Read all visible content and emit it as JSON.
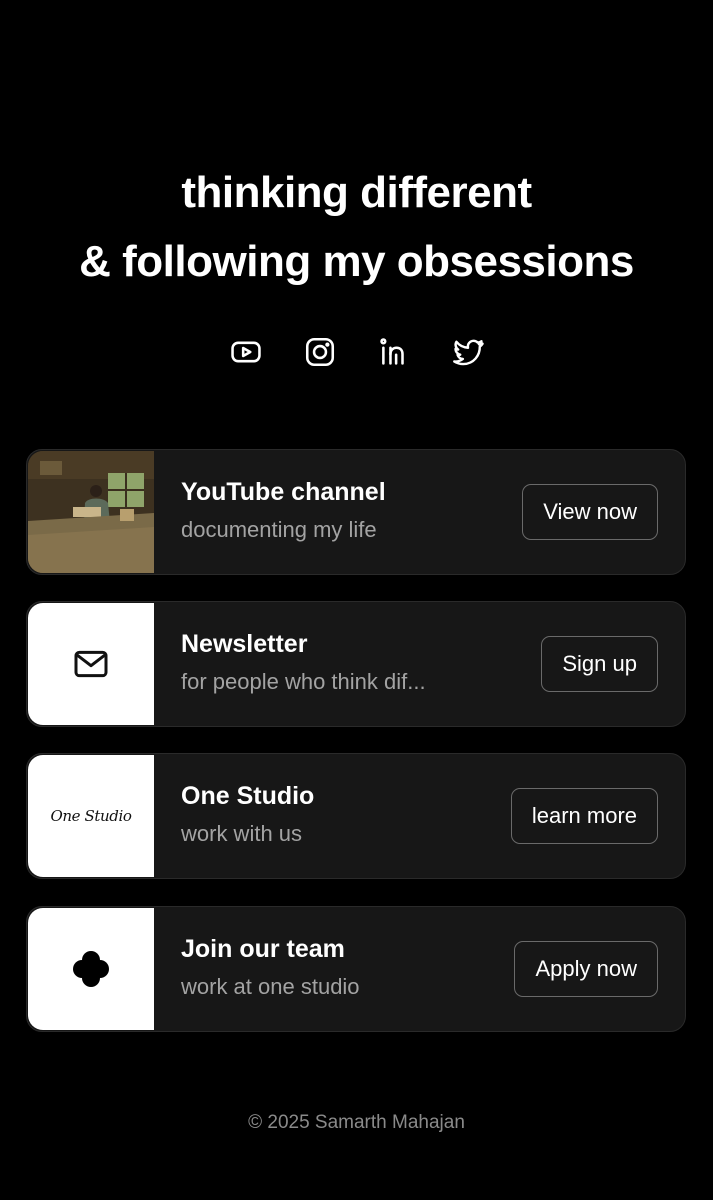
{
  "hero": {
    "line1": "thinking different",
    "line2": "& following my obsessions"
  },
  "socials": [
    {
      "icon": "youtube-icon"
    },
    {
      "icon": "instagram-icon"
    },
    {
      "icon": "linkedin-icon"
    },
    {
      "icon": "twitter-icon"
    }
  ],
  "cards": [
    {
      "title": "YouTube channel",
      "subtitle": "documenting my life",
      "button": "View now",
      "thumb": "photo"
    },
    {
      "title": "Newsletter",
      "subtitle": "for people who think dif...",
      "button": "Sign up",
      "thumb": "mail-icon"
    },
    {
      "title": "One Studio",
      "subtitle": "work with us",
      "button": "learn more",
      "thumb": "One Studio"
    },
    {
      "title": "Join our team",
      "subtitle": "work at one studio",
      "button": "Apply now",
      "thumb": "clover-icon"
    }
  ],
  "footer": "© 2025 Samarth Mahajan",
  "colors": {
    "background": "#000000",
    "card": "#171717",
    "muted": "#a3a3a3"
  }
}
